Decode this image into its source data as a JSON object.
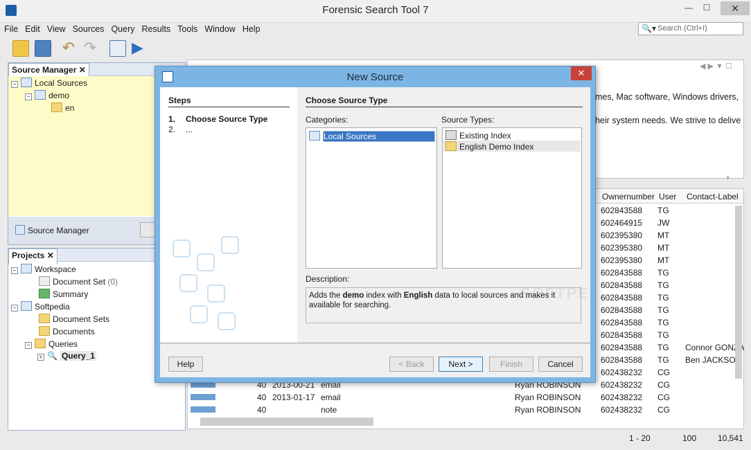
{
  "window": {
    "title": "Forensic Search Tool 7",
    "min": "—",
    "max": "☐",
    "close": "✕"
  },
  "menu": [
    "File",
    "Edit",
    "View",
    "Sources",
    "Query",
    "Results",
    "Tools",
    "Window",
    "Help"
  ],
  "search": {
    "placeholder": "Search (Ctrl+I)"
  },
  "source_manager": {
    "tab": "Source Manager",
    "tree": {
      "root": "Local Sources",
      "child": "demo",
      "leaf": "en"
    },
    "footer_label": "Source Manager",
    "footer_btn": "Cl"
  },
  "projects": {
    "tab": "Projects",
    "workspace": "Workspace",
    "document_set": "Document Set",
    "document_set_count": "(0)",
    "summary": "Summary",
    "softpedia": "Softpedia",
    "document_sets": "Document Sets",
    "documents": "Documents",
    "queries": "Queries",
    "query_1": "Query_1"
  },
  "preview_text": {
    "line1": "mes, Mac software, Windows drivers,",
    "line2": "heir system needs. We strive to delive"
  },
  "table": {
    "headers": [
      "Ownernumber",
      "User",
      "Contact-Label"
    ],
    "rows": [
      [
        "602843588",
        "TG",
        ""
      ],
      [
        "602464915",
        "JW",
        ""
      ],
      [
        "602395380",
        "MT",
        ""
      ],
      [
        "602395380",
        "MT",
        ""
      ],
      [
        "602395380",
        "MT",
        ""
      ],
      [
        "602843588",
        "TG",
        ""
      ],
      [
        "602843588",
        "TG",
        ""
      ],
      [
        "602843588",
        "TG",
        ""
      ],
      [
        "602843588",
        "TG",
        ""
      ],
      [
        "602843588",
        "TG",
        ""
      ],
      [
        "602843588",
        "TG",
        ""
      ],
      [
        "602843588",
        "TG",
        "Connor GONZA"
      ],
      [
        "602843588",
        "TG",
        "Ben JACKSON"
      ],
      [
        "602438232",
        "CG",
        ""
      ],
      [
        "602438232",
        "CG",
        ""
      ],
      [
        "602438232",
        "CG",
        ""
      ],
      [
        "602438232",
        "CG",
        ""
      ]
    ],
    "bottom_rows": [
      {
        "score": "40",
        "date": "2013-00-21",
        "type": "email",
        "name": "Ryan ROBINSON"
      },
      {
        "score": "40",
        "date": "2013-01-17",
        "type": "email",
        "name": "Ryan ROBINSON"
      },
      {
        "score": "40",
        "date": "",
        "type": "note",
        "name": "Ryan ROBINSON"
      }
    ]
  },
  "statusbar": {
    "range": "1 - 20",
    "zoom": "100",
    "total": "10,541"
  },
  "dialog": {
    "title": "New Source",
    "steps_heading": "Steps",
    "step1_num": "1.",
    "step1": "Choose Source Type",
    "step2_num": "2.",
    "step2": "...",
    "section_title": "Choose Source Type",
    "categories_label": "Categories:",
    "categories": [
      "Local Sources"
    ],
    "source_types_label": "Source Types:",
    "source_types": [
      "Existing Index",
      "English Demo Index"
    ],
    "description_label": "Description:",
    "description": {
      "part1": "Adds the ",
      "bold1": "demo",
      "part2": " index with ",
      "bold2": "English",
      "part3": " data to local sources and makes it available for searching."
    },
    "buttons": {
      "help": "Help",
      "back": "< Back",
      "next": "Next >",
      "finish": "Finish",
      "cancel": "Cancel"
    },
    "watermark": "SOFTPE"
  }
}
